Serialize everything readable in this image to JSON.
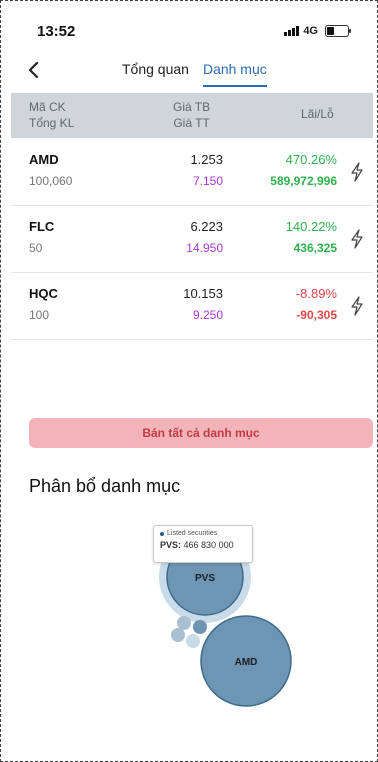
{
  "status": {
    "time": "13:52",
    "network": "4G"
  },
  "nav": {
    "back_icon": "chevron-left-icon",
    "tabs": [
      {
        "label": "Tổng quan"
      },
      {
        "label": "Danh mục"
      }
    ]
  },
  "table": {
    "header": {
      "col1_line1": "Mã CK",
      "col1_line2": "Tổng KL",
      "col2_line1": "Giá TB",
      "col2_line2": "Giá TT",
      "col3": "Lãi/Lỗ"
    },
    "rows": [
      {
        "symbol": "AMD",
        "qty": "100,060",
        "avg_price": "1.253",
        "cur_price": "7.150",
        "pct": "470.26%",
        "pl": "589,972,996",
        "trend": "pos"
      },
      {
        "symbol": "FLC",
        "qty": "50",
        "avg_price": "6.223",
        "cur_price": "14.950",
        "pct": "140.22%",
        "pl": "436,325",
        "trend": "pos"
      },
      {
        "symbol": "HQC",
        "qty": "100",
        "avg_price": "10.153",
        "cur_price": "9.250",
        "pct": "-8.89%",
        "pl": "-90,305",
        "trend": "neg"
      }
    ]
  },
  "sell_all_label": "Bán tất cả danh mục",
  "allocation": {
    "title": "Phân bổ danh mục",
    "tooltip": {
      "series": "Listed securities",
      "label": "PVS:",
      "value": "466 830 000"
    },
    "bubble_labels": [
      "PVS",
      "AMD"
    ],
    "colors": {
      "bubble": "#6e95b3",
      "bubble_stroke": "#3e6b8a",
      "halo": "#c9dbe8"
    }
  }
}
